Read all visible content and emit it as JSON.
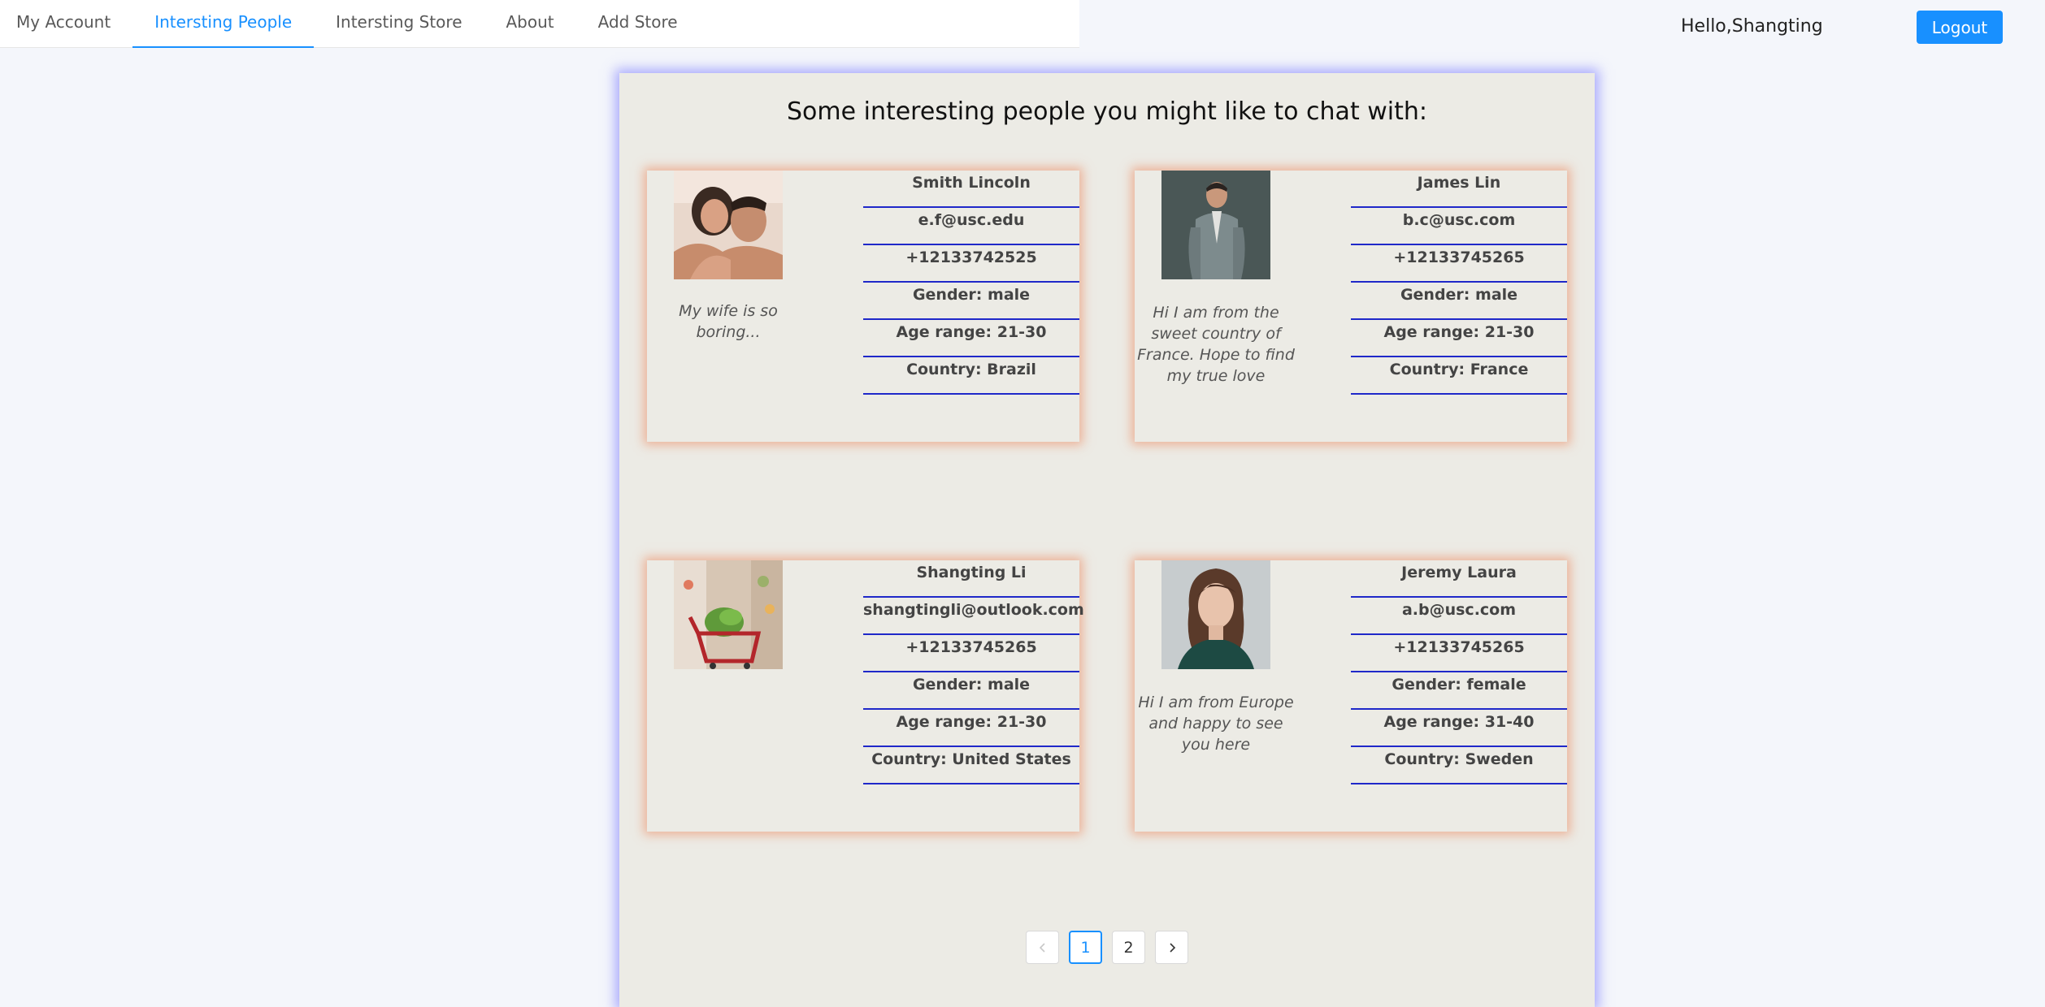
{
  "nav": {
    "tabs": [
      {
        "label": "My Account"
      },
      {
        "label": "Intersting People"
      },
      {
        "label": "Intersting Store"
      },
      {
        "label": "About"
      },
      {
        "label": "Add Store"
      }
    ],
    "active_tab": "Intersting People"
  },
  "header": {
    "greeting": "Hello,Shangting",
    "logout_label": "Logout"
  },
  "main": {
    "title": "Some interesting people you might like to chat with:"
  },
  "people": [
    {
      "name": "Smith Lincoln",
      "email": "e.f@usc.edu",
      "phone": "+12133742525",
      "gender": "Gender: male",
      "age": "Age range: 21-30",
      "country": "Country: Brazil",
      "bio": "My wife is so boring...",
      "avatar": "couple-photo"
    },
    {
      "name": "James Lin",
      "email": "b.c@usc.com",
      "phone": "+12133745265",
      "gender": "Gender: male",
      "age": "Age range: 21-30",
      "country": "Country: France",
      "bio": "Hi I am from the sweet country of France. Hope to find my true love",
      "avatar": "man-in-suit-photo"
    },
    {
      "name": "Shangting Li",
      "email": "shangtingli@outlook.com",
      "phone": "+12133745265",
      "gender": "Gender: male",
      "age": "Age range: 21-30",
      "country": "Country: United States",
      "bio": "",
      "avatar": "grocery-cart-photo"
    },
    {
      "name": "Jeremy Laura",
      "email": "a.b@usc.com",
      "phone": "+12133745265",
      "gender": "Gender: female",
      "age": "Age range: 31-40",
      "country": "Country: Sweden",
      "bio": "Hi I am from Europe and happy to see you here",
      "avatar": "woman-portrait-photo"
    }
  ],
  "pagination": {
    "pages": [
      "1",
      "2"
    ],
    "current": "1"
  },
  "colors": {
    "accent": "#1890ff",
    "field_underline": "#1f28c9",
    "panel_bg": "#ecebe5",
    "panel_glow": "#6e6eff",
    "card_glow": "#ec8c64"
  }
}
